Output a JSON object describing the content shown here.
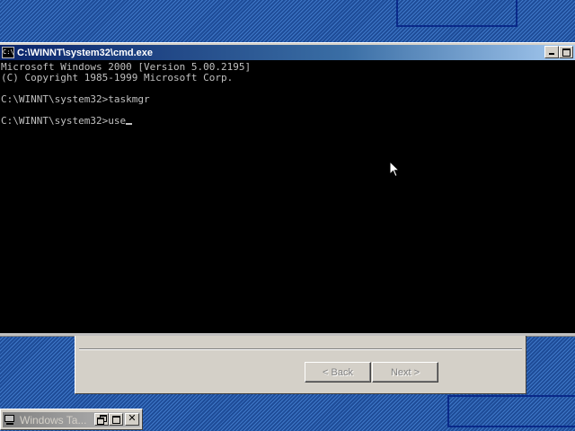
{
  "console": {
    "title": "C:\\WINNT\\system32\\cmd.exe",
    "icon_label": "C:\\",
    "lines": {
      "version": "Microsoft Windows 2000 [Version 5.00.2195]",
      "copyright": "(C) Copyright 1985-1999 Microsoft Corp.",
      "cmd1": "C:\\WINNT\\system32>taskmgr",
      "cmd2": "C:\\WINNT\\system32>use"
    }
  },
  "wizard": {
    "back_label": "< Back",
    "next_label": "Next >"
  },
  "taskbar_window": {
    "label": "Windows Ta...",
    "close_glyph": "✕"
  },
  "icons": {
    "console": "console-icon",
    "minimize": "minimize-icon",
    "maximize": "maximize-icon",
    "restore": "restore-icon",
    "close": "close-icon",
    "computer": "computer-icon",
    "cursor": "mouse-cursor"
  },
  "colors": {
    "title_active": "#0a246a",
    "title_inactive": "#808080",
    "console_bg": "#000000",
    "console_text": "#c0c0c0",
    "desktop": "#1f4f9a",
    "face": "#d4d0c8"
  }
}
